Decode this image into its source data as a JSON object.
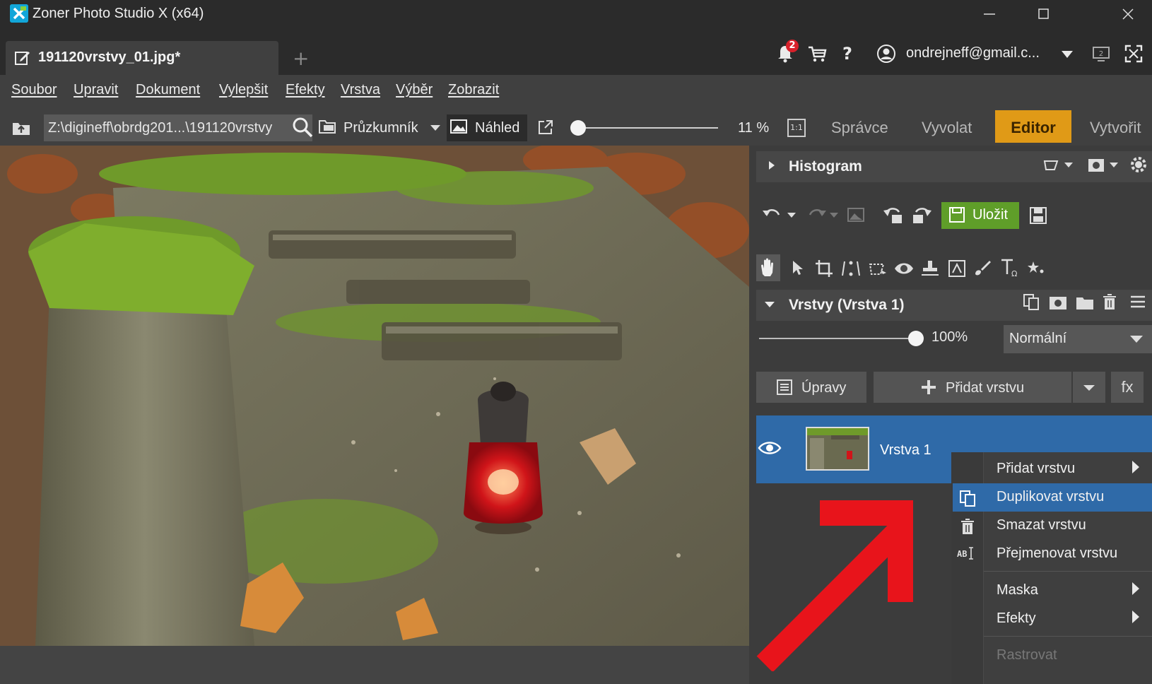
{
  "window": {
    "title": "Zoner Photo Studio X (x64)",
    "controls": [
      "minimize-icon",
      "maximize-icon",
      "close-icon"
    ]
  },
  "tabs": {
    "document": "191120vrstvy_01.jpg*",
    "new_tab": "+"
  },
  "header": {
    "notification_count": "2",
    "help": "?",
    "account": "ondrejneff@gmail.c...",
    "icons": [
      "bell-icon",
      "cart-icon",
      "help-icon",
      "user-icon",
      "monitor-icon",
      "fullscreen-icon"
    ]
  },
  "menu": {
    "items": [
      "Soubor",
      "Upravit",
      "Dokument",
      "Vylepšit",
      "Efekty",
      "Vrstva",
      "Výběr",
      "Zobrazit"
    ]
  },
  "toolbar": {
    "path": "Z:\\digineff\\obrdg201...\\191120vrstvy",
    "explorer": "Průzkumník",
    "preview": "Náhled",
    "zoom": "11 %",
    "zoom_fraction": 0.05,
    "ratio": "1:1",
    "modes": [
      "Správce",
      "Vyvolat",
      "Editor",
      "Vytvořit"
    ],
    "active_mode": "Editor"
  },
  "panel": {
    "histogram_title": "Histogram",
    "save_label": "Uložit",
    "layers_title": "Vrstvy (Vrstva 1)",
    "opacity": "100%",
    "opacity_fraction": 1.0,
    "blend_mode": "Normální",
    "adjustments_label": "Úpravy",
    "add_layer_label": "Přidat vrstvu",
    "fx_label": "fx",
    "layer_name": "Vrstva 1"
  },
  "context_menu": {
    "items": [
      {
        "label": "Přidat vrstvu",
        "submenu": true,
        "icon": ""
      },
      {
        "label": "Duplikovat vrstvu",
        "submenu": false,
        "icon": "duplicate-icon",
        "highlighted": true
      },
      {
        "label": "Smazat vrstvu",
        "submenu": false,
        "icon": "trash-icon"
      },
      {
        "label": "Přejmenovat vrstvu",
        "submenu": false,
        "icon": "rename-icon"
      },
      {
        "label": "Maska",
        "submenu": true,
        "icon": ""
      },
      {
        "label": "Efekty",
        "submenu": true,
        "icon": ""
      },
      {
        "label": "Rastrovat",
        "submenu": false,
        "icon": "",
        "disabled": true
      }
    ]
  },
  "colors": {
    "accent": "#e09a17",
    "selection": "#2f6aa8",
    "save": "#5f9e29",
    "annotation_arrow": "#e8141b"
  }
}
